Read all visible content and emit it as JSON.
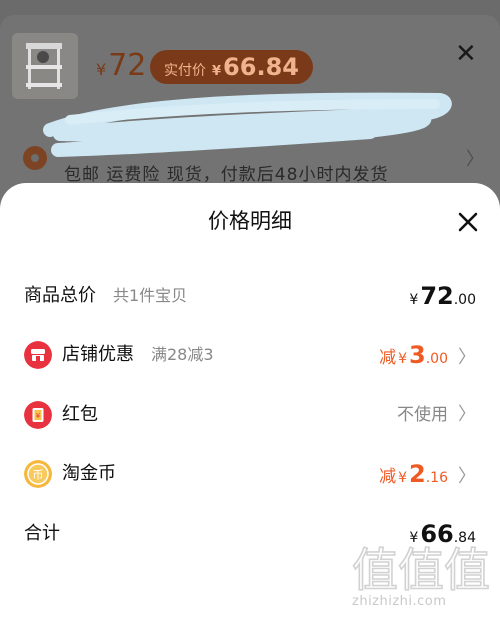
{
  "background": {
    "price_yen": "¥",
    "price": "72",
    "badge_label": "实付价",
    "badge_yen": "¥",
    "badge_value": "66.84",
    "service_line": "包邮  运费险  现货，付款后48小时内发货",
    "close_icon": "close-icon"
  },
  "sheet": {
    "title": "价格明细",
    "close_icon": "close-icon",
    "rows": [
      {
        "name": "商品总价",
        "note": "共1件宝贝",
        "prefix": "",
        "yen": "¥",
        "int": "72",
        "dec": ".00",
        "color": "#111111"
      },
      {
        "name": "店铺优惠",
        "note": "满28减3",
        "icon": "shop-icon",
        "icon_color": "#e8323f",
        "prefix": "减",
        "yen": "¥",
        "int": "3",
        "dec": ".00",
        "color": "#ef5a23"
      },
      {
        "name": "红包",
        "icon": "red-envelope-icon",
        "icon_color": "#e8323f",
        "status": "不使用"
      },
      {
        "name": "淘金币",
        "icon": "coin-icon",
        "icon_color": "#f5b73c",
        "prefix": "减",
        "yen": "¥",
        "int": "2",
        "dec": ".16",
        "color": "#ef5a23"
      },
      {
        "name": "合计",
        "yen": "¥",
        "int": "66",
        "dec": ".84",
        "color": "#111111"
      }
    ]
  },
  "watermark": {
    "logo_text": "值值值",
    "site": "zhizhizhi.com"
  }
}
